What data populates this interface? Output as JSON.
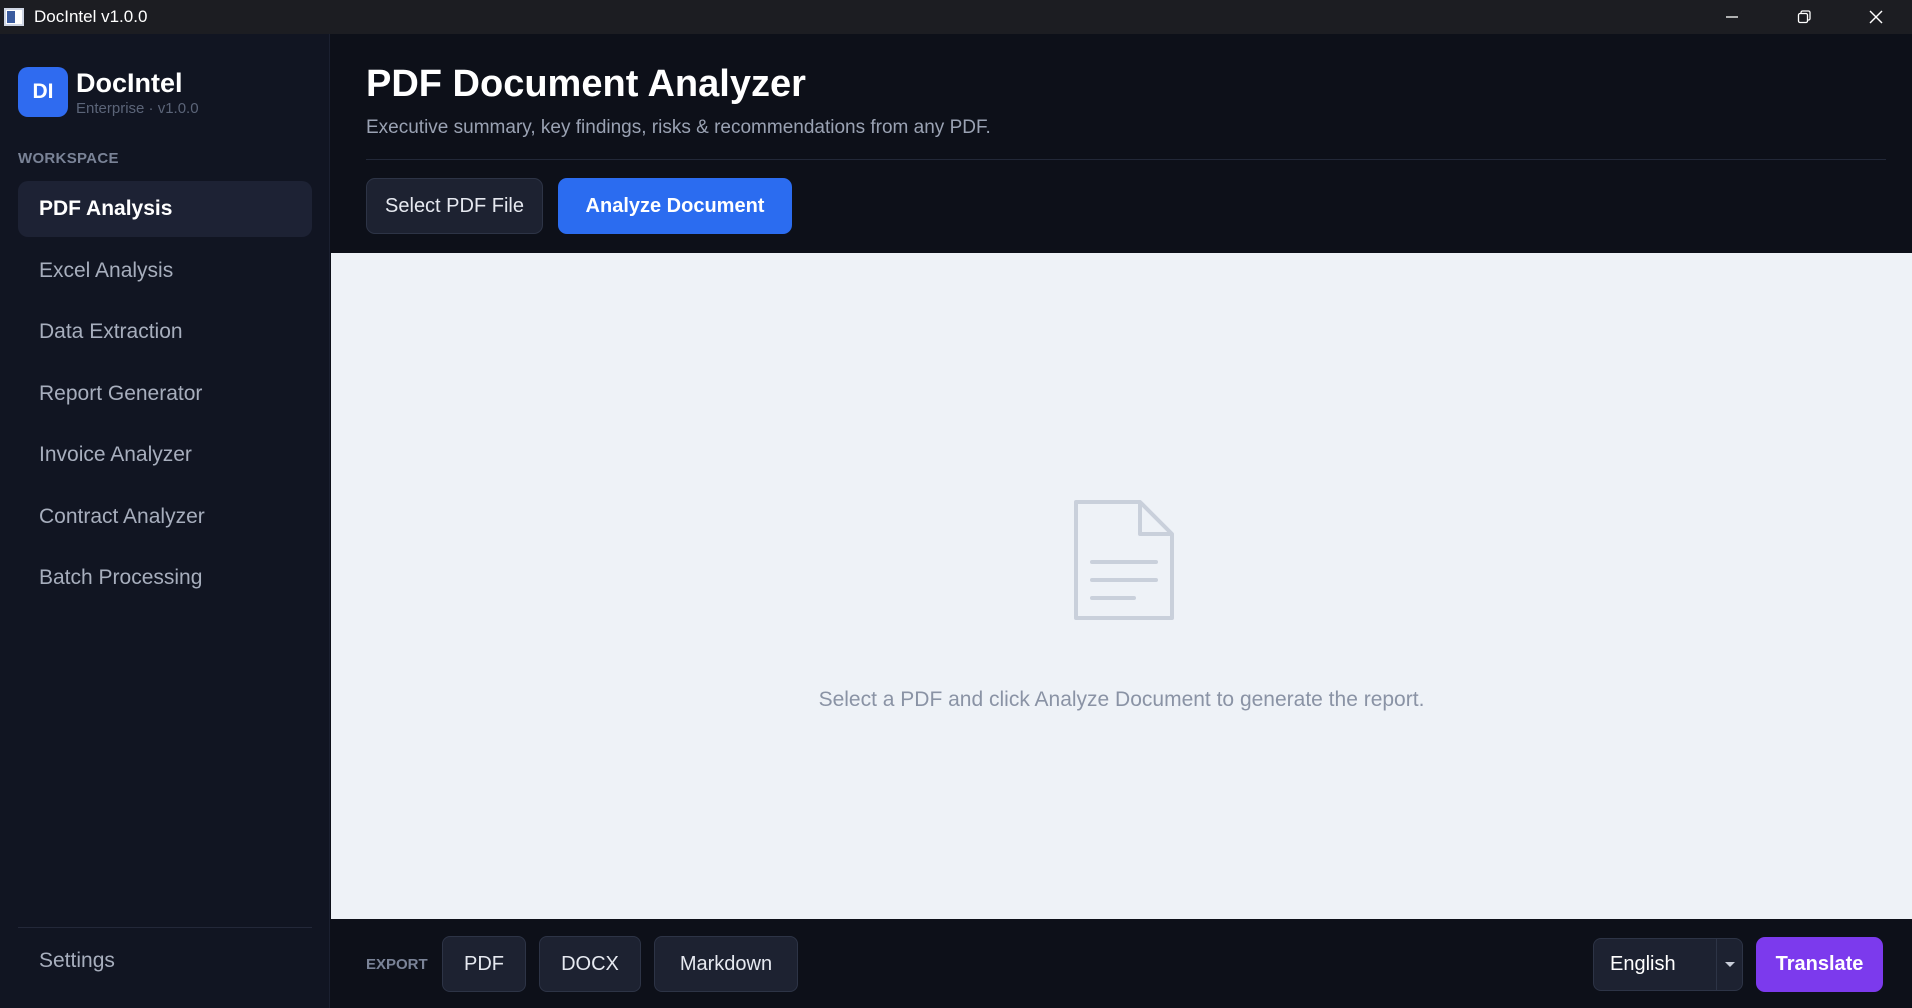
{
  "window": {
    "title": "DocIntel v1.0.0"
  },
  "sidebar": {
    "brand_badge": "DI",
    "brand_name": "DocIntel",
    "brand_sub": "Enterprise · v1.0.0",
    "section_label": "WORKSPACE",
    "items": [
      {
        "label": "PDF Analysis",
        "active": true
      },
      {
        "label": "Excel Analysis",
        "active": false
      },
      {
        "label": "Data Extraction",
        "active": false
      },
      {
        "label": "Report Generator",
        "active": false
      },
      {
        "label": "Invoice Analyzer",
        "active": false
      },
      {
        "label": "Contract Analyzer",
        "active": false
      },
      {
        "label": "Batch Processing",
        "active": false
      }
    ],
    "settings_label": "Settings"
  },
  "header": {
    "title": "PDF Document Analyzer",
    "subtitle": "Executive summary, key findings, risks & recommendations from any PDF.",
    "select_button": "Select PDF File",
    "analyze_button": "Analyze Document"
  },
  "content": {
    "empty_message": "Select a PDF and click Analyze Document to generate the report.",
    "icon": "document-icon"
  },
  "footer": {
    "export_label": "EXPORT",
    "export_pdf": "PDF",
    "export_docx": "DOCX",
    "export_markdown": "Markdown",
    "language_selected": "English",
    "translate_button": "Translate"
  },
  "colors": {
    "accent_blue": "#2b6cf0",
    "accent_purple": "#7c3aed",
    "sidebar_bg": "#111522",
    "content_bg": "#eef2f7"
  }
}
